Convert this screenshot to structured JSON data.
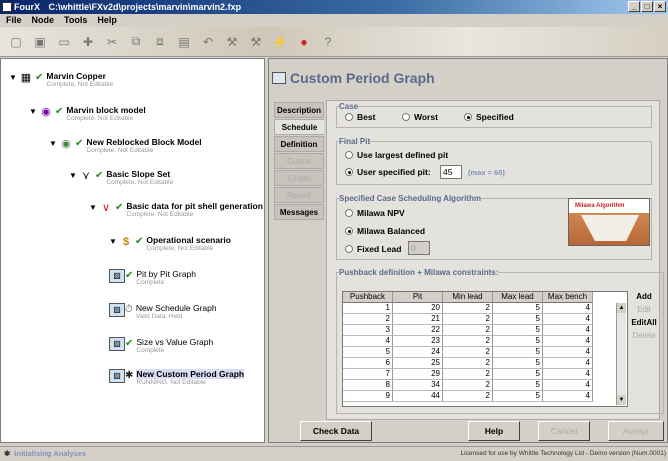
{
  "window": {
    "app_title": "FourX",
    "path": "C:\\whittle\\FXv2d\\projects\\marvin\\marvin2.fxp"
  },
  "menu": [
    "File",
    "Node",
    "Tools",
    "Help"
  ],
  "tree": [
    {
      "label": "Marvin Copper",
      "status": "Complete, Not Editable",
      "icon": "copper-icon"
    },
    {
      "label": "Marvin block model",
      "status": "Complete, Not Editable",
      "icon": "block-model-icon"
    },
    {
      "label": "New Reblocked Block Model",
      "status": "Complete, Not Editable",
      "icon": "reblocked-icon"
    },
    {
      "label": "Basic Slope Set",
      "status": "Complete, Not Editable",
      "icon": "slope-icon"
    },
    {
      "label": "Basic data for pit shell generation",
      "status": "Complete, Not Editable",
      "icon": "pit-shell-icon"
    },
    {
      "label": "Operational scenario",
      "status": "Complete, Not Editable",
      "icon": "dollar-icon"
    },
    {
      "label": "Pit by Pit Graph",
      "status": "Complete",
      "icon": "graph-icon"
    },
    {
      "label": "New Schedule Graph",
      "status": "Valid Data, Held",
      "icon": "graph-icon"
    },
    {
      "label": "Size vs Value Graph",
      "status": "Complete",
      "icon": "graph-icon"
    },
    {
      "label": "New Custom Period Graph",
      "status": "RUNNING, Not Editable",
      "icon": "graph-icon"
    }
  ],
  "panel_title": "Custom Period Graph",
  "tabs": [
    {
      "label": "Description",
      "state": "normal"
    },
    {
      "label": "Schedule",
      "state": "active"
    },
    {
      "label": "Definition",
      "state": "normal"
    },
    {
      "label": "Output",
      "state": "disabled"
    },
    {
      "label": "Graph",
      "state": "disabled"
    },
    {
      "label": "Report",
      "state": "disabled"
    },
    {
      "label": "Messages",
      "state": "normal"
    }
  ],
  "case": {
    "legend": "Case",
    "options": [
      "Best",
      "Worst",
      "Specified"
    ],
    "selected": "Specified"
  },
  "final_pit": {
    "legend": "Final Pit",
    "opt1": "Use largest defined pit",
    "opt2": "User specified pit:",
    "value": "45",
    "hint": "(max = 60)"
  },
  "algorithm": {
    "legend": "Specified Case Scheduling Algorithm",
    "options": [
      "Milawa NPV",
      "Milawa Balanced",
      "Fixed Lead"
    ],
    "selected": "Milawa Balanced",
    "fixed_lead_value": "0",
    "image_caption": "Milawa Algorithm"
  },
  "pushback": {
    "legend": "Pushback definition + Milawa constraints:",
    "headers": [
      "Pushback",
      "Pit",
      "Min lead",
      "Max lead",
      "Max bench"
    ],
    "rows": [
      [
        "1",
        "20",
        "2",
        "5",
        "4"
      ],
      [
        "2",
        "21",
        "2",
        "5",
        "4"
      ],
      [
        "3",
        "22",
        "2",
        "5",
        "4"
      ],
      [
        "4",
        "23",
        "2",
        "5",
        "4"
      ],
      [
        "5",
        "24",
        "2",
        "5",
        "4"
      ],
      [
        "6",
        "25",
        "2",
        "5",
        "4"
      ],
      [
        "7",
        "29",
        "2",
        "5",
        "4"
      ],
      [
        "8",
        "34",
        "2",
        "5",
        "4"
      ],
      [
        "9",
        "44",
        "2",
        "5",
        "4"
      ]
    ],
    "side_buttons": [
      {
        "label": "Add",
        "enabled": true
      },
      {
        "label": "Edit",
        "enabled": false
      },
      {
        "label": "EditAll",
        "enabled": true
      },
      {
        "label": "Delete",
        "enabled": false
      }
    ]
  },
  "buttons": {
    "check_data": "Check Data",
    "help": "Help",
    "cancel": "Cancel",
    "accept": "Accept"
  },
  "status": {
    "left": "Initialising Analyses",
    "right": "Licensed for use by Whittle Technology Ltd - Demo version (Num.0001)"
  }
}
